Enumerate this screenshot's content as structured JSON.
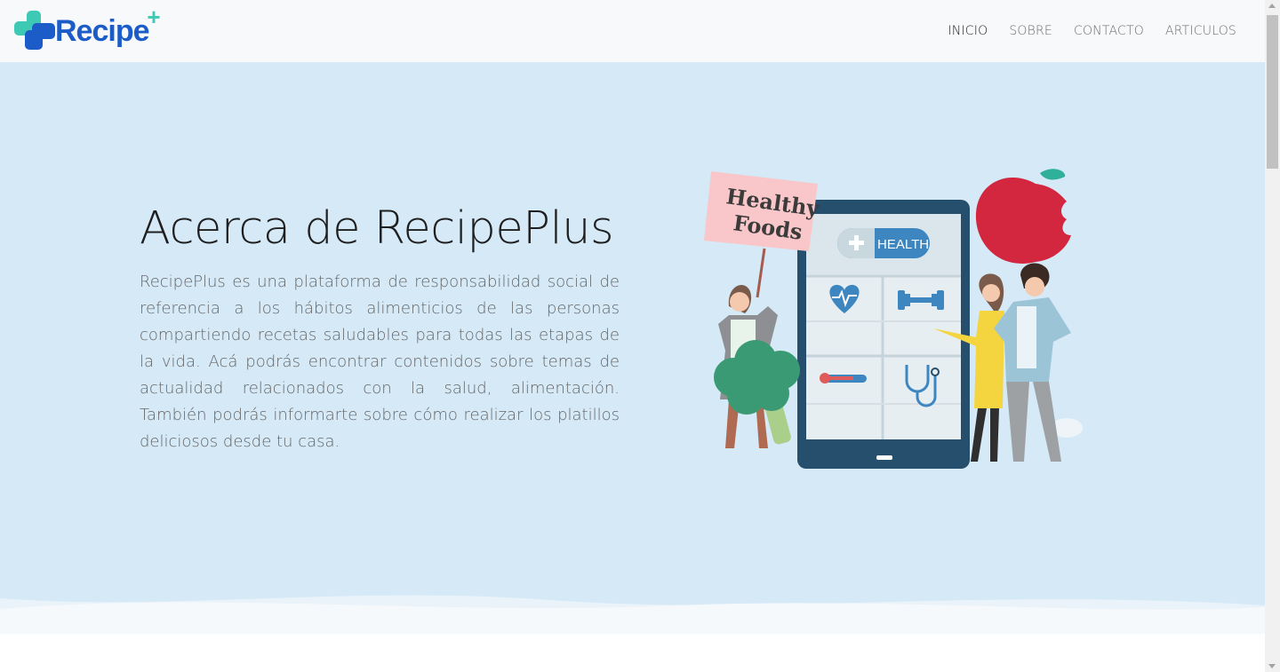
{
  "brand": {
    "name": "Recipe",
    "plus": "+"
  },
  "nav": {
    "items": [
      {
        "label": "INICIO",
        "active": true
      },
      {
        "label": "SOBRE",
        "active": false
      },
      {
        "label": "CONTACTO",
        "active": false
      },
      {
        "label": "ARTICULOS",
        "active": false
      }
    ]
  },
  "hero": {
    "title": "Acerca de RecipePlus",
    "description": "RecipePlus es una plataforma de responsabilidad social de referencia a los hábitos alimenticios de las personas compartiendo recetas saludables para todas las etapas de la vida. Acá podrás encontrar contenidos sobre temas de actualidad relacionados con la salud, alimentación. También podrás informarte sobre cómo realizar los platillos deliciosos desde tu casa."
  },
  "illustration": {
    "sign_line1": "Healthy",
    "sign_line2": "Foods",
    "health_label": "HEALTH",
    "icons": [
      "heart-rate-icon",
      "dumbbell-icon",
      "thermometer-icon",
      "stethoscope-icon"
    ]
  },
  "colors": {
    "brand_blue": "#1c5cc8",
    "brand_teal": "#3ec9b4",
    "hero_bg": "#d5e9f7",
    "navbar_bg": "#f8f9fa"
  }
}
